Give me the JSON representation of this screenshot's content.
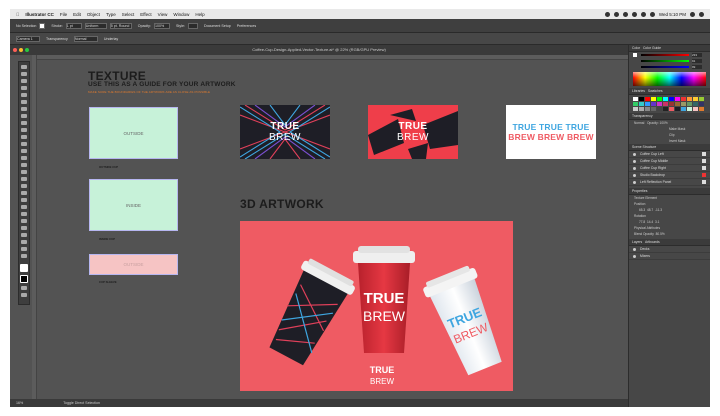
{
  "menubar": {
    "app_name": "Illustrator CC",
    "items": [
      "File",
      "Edit",
      "Object",
      "Type",
      "Select",
      "Effect",
      "View",
      "Window",
      "Help"
    ],
    "clock": "Wed 5:10 PM"
  },
  "control_bar": {
    "selection_label": "No Selection",
    "stroke_label": "Stroke:",
    "stroke_value": "1 pt",
    "uniform_label": "Uniform",
    "brush_label": "5 pt. Round",
    "opacity_label": "Opacity:",
    "opacity_value": "100%",
    "style_label": "Style:",
    "doc_setup": "Document Setup",
    "preferences": "Preferences"
  },
  "control_bar2": {
    "layer_label": "Camera 1",
    "transparency_label": "Transparency",
    "blend_value": "Normal",
    "visibility_label": "Underlay"
  },
  "document": {
    "tab_title": "Coffee-Cup-Design-Applied-Vector-Texture.ai* @ 22% (RGB/GPU Preview)",
    "status_zoom": "16%",
    "status_tool": "Toggle Direct Selection"
  },
  "artboard": {
    "texture_heading": "TEXTURE",
    "guide_heading": "USE THIS AS A GUIDE FOR YOUR ARTWORK",
    "guide_sub": "MAKE SURE THE BOUNDARIES OF THE ARTWORK ARE AS CLOSE AS POSSIBLE",
    "swatch_outside": "OUTSIDE",
    "swatch_outside_caption": "OUTSIDE CUP",
    "swatch_inside": "INSIDE",
    "swatch_inside_caption": "INSIDE CUP",
    "swatch_pink": "OUTSIDE",
    "swatch_pink_caption": "CUP SLEEVE",
    "heading_3d": "3D ARTWORK",
    "brand_word1": "TRUE",
    "brand_word2": "BREW",
    "white_row1": "TRUE TRUE TRUE",
    "white_row2": "BREW BREW BREW"
  },
  "colors": {
    "app_bg": "#535353",
    "dark_card": "#1e1e26",
    "red_card": "#ef3e4a",
    "art_pink": "#ef5b63",
    "mint": "#c7f2d9",
    "pink_swatch": "#f6c4c4",
    "accent_blue": "#3fa6e0",
    "accent_orange": "#e07a2e"
  },
  "panels": {
    "color_tab": "Color",
    "color_guide_tab": "Color Guide",
    "color_values": [
      "233",
      "91",
      "99"
    ],
    "libraries_tab": "Libraries",
    "swatches_tab": "Swatches",
    "transparency_tab": "Transparency",
    "transparency_mode": "Normal",
    "opacity_label": "Opacity:",
    "opacity_value": "100%",
    "make_mask": "Make Mask",
    "clip": "Clip",
    "invert_mask": "Invert Mask",
    "scene_structure_tab": "Scene Structure",
    "scene_items": [
      "Coffee Cup Left",
      "Coffee Cup Middle",
      "Coffee Cup Right",
      "Studio Backdrop",
      "Left Reflection Panel"
    ],
    "properties_tab": "Properties",
    "properties_rows": [
      "Texture Element",
      "Position",
      "Rotation",
      "Physical Attributes",
      "Blend Opacity"
    ],
    "position_values": [
      "65.3",
      "48.7",
      "-11.3"
    ],
    "rotation_values": [
      "77.8",
      "14.4",
      "3.1"
    ],
    "blend_value": "80.5%",
    "layers_tab": "Layers",
    "artboards_tab": "Artboards",
    "layers": [
      "Decks",
      "Mixers"
    ]
  }
}
